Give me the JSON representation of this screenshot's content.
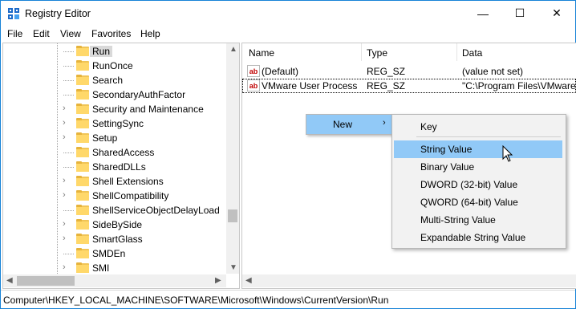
{
  "window": {
    "title": "Registry Editor",
    "controls": {
      "minimize": "—",
      "maximize": "☐",
      "close": "✕"
    }
  },
  "menubar": [
    "File",
    "Edit",
    "View",
    "Favorites",
    "Help"
  ],
  "tree": {
    "items": [
      {
        "label": "Run",
        "expandable": false,
        "selected": true
      },
      {
        "label": "RunOnce",
        "expandable": false
      },
      {
        "label": "Search",
        "expandable": false
      },
      {
        "label": "SecondaryAuthFactor",
        "expandable": false
      },
      {
        "label": "Security and Maintenance",
        "expandable": true
      },
      {
        "label": "SettingSync",
        "expandable": true
      },
      {
        "label": "Setup",
        "expandable": true
      },
      {
        "label": "SharedAccess",
        "expandable": false
      },
      {
        "label": "SharedDLLs",
        "expandable": false
      },
      {
        "label": "Shell Extensions",
        "expandable": true
      },
      {
        "label": "ShellCompatibility",
        "expandable": true
      },
      {
        "label": "ShellServiceObjectDelayLoad",
        "expandable": false
      },
      {
        "label": "SideBySide",
        "expandable": true
      },
      {
        "label": "SmartGlass",
        "expandable": true
      },
      {
        "label": "SMDEn",
        "expandable": false
      },
      {
        "label": "SMI",
        "expandable": true
      }
    ]
  },
  "list": {
    "columns": {
      "name": "Name",
      "type": "Type",
      "data": "Data"
    },
    "rows": [
      {
        "icon": "ab",
        "name": "(Default)",
        "type": "REG_SZ",
        "data": "(value not set)"
      },
      {
        "icon": "ab",
        "name": "VMware User Process",
        "type": "REG_SZ",
        "data": "\"C:\\Program Files\\VMware"
      }
    ]
  },
  "context_menu": {
    "label": "New",
    "submenu_arrow": "›"
  },
  "submenu": {
    "items": [
      "Key",
      "String Value",
      "Binary Value",
      "DWORD (32-bit) Value",
      "QWORD (64-bit) Value",
      "Multi-String Value",
      "Expandable String Value"
    ],
    "hot_index": 1
  },
  "statusbar": {
    "path": "Computer\\HKEY_LOCAL_MACHINE\\SOFTWARE\\Microsoft\\Windows\\CurrentVersion\\Run"
  },
  "colors": {
    "menu_highlight": "#91c9f7",
    "window_border": "#1883d7",
    "folder": "#ffd86a"
  }
}
